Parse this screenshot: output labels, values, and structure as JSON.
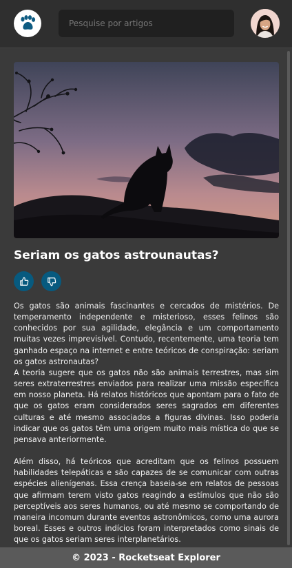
{
  "header": {
    "logo_icon": "paw-icon",
    "search": {
      "placeholder": "Pesquise por artigos",
      "value": ""
    },
    "avatar_icon": "user-avatar"
  },
  "article": {
    "image_icon": "cat-silhouette-sunset-image",
    "title": "Seriam os gatos astrounautas?",
    "like_icon": "thumbs-up-icon",
    "dislike_icon": "thumbs-down-icon",
    "paragraphs": [
      "Os gatos são animais fascinantes e cercados de mistérios. De temperamento independente e misterioso, esses felinos são conhecidos por sua agilidade, elegância e um comportamento muitas vezes imprevisível. Contudo, recentemente, uma teoria tem ganhado espaço na internet e entre teóricos de conspiração: seriam os gatos astronautas?",
      "A teoria sugere que os gatos não são animais terrestres, mas sim seres extraterrestres enviados para realizar uma missão específica em nosso planeta. Há relatos históricos que apontam para o fato de que os gatos eram considerados seres sagrados em diferentes culturas e até mesmo associados a figuras divinas. Isso poderia indicar que os gatos têm uma origem muito mais mística do que se pensava anteriormente.",
      "Além disso, há teóricos que acreditam que os felinos possuem habilidades telepáticas e são capazes de se comunicar com outras espécies alienígenas. Essa crença baseia-se em relatos de pessoas que afirmam terem visto gatos reagindo a estímulos que não são perceptíveis aos seres humanos, ou até mesmo se comportando de maneira incomum durante eventos astronômicos, como uma aurora boreal. Esses e outros indícios foram interpretados como sinais de que os gatos seriam seres interplanetários."
    ]
  },
  "footer": {
    "text": "© 2023 - Rocketseat Explorer"
  },
  "colors": {
    "header_bg": "#2f2f2f",
    "page_bg": "#3a3a3a",
    "button_bg": "#075a7f",
    "footer_bg": "#5a5a5a"
  }
}
